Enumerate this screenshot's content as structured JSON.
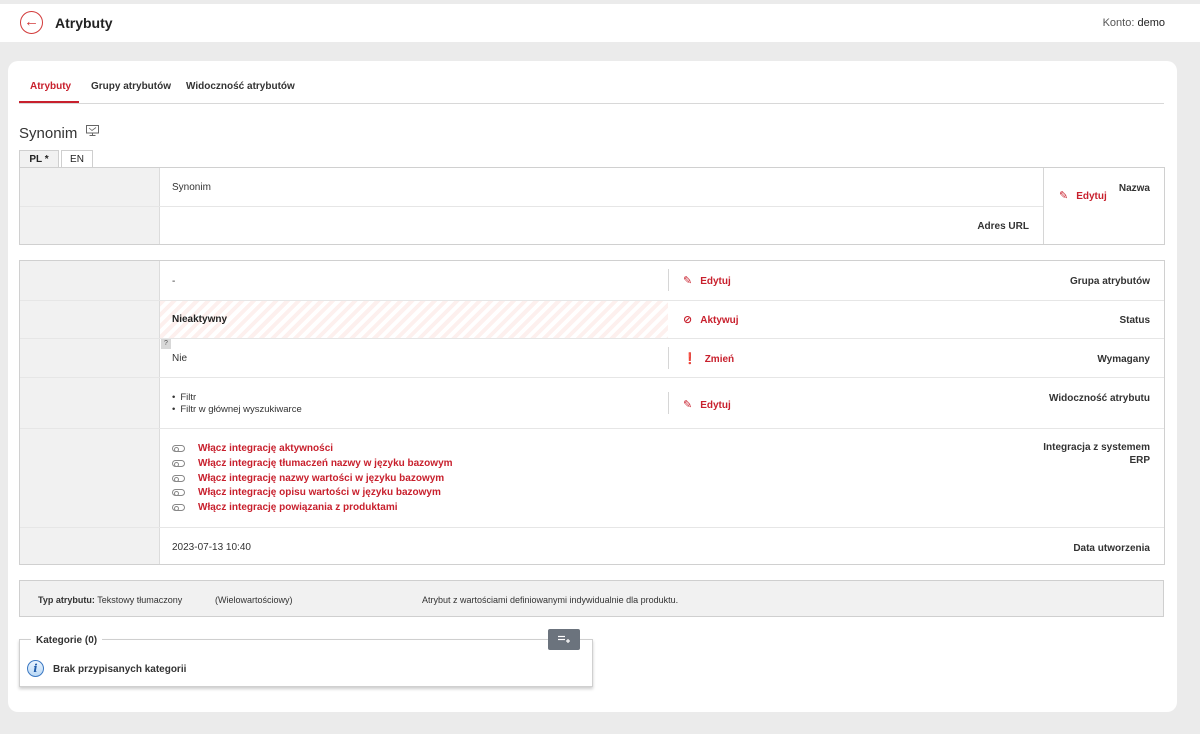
{
  "header": {
    "title": "Atrybuty",
    "account_label": "Konto:",
    "account_name": "demo",
    "back_icon": "arrow-left-icon"
  },
  "tabs": [
    {
      "label": "Atrybuty",
      "active": true
    },
    {
      "label": "Grupy atrybutów",
      "active": false
    },
    {
      "label": "Widoczność atrybutów",
      "active": false
    }
  ],
  "attribute": {
    "name": "Synonim"
  },
  "language_tabs": [
    "PL *",
    "EN"
  ],
  "translation_box": {
    "rows": [
      {
        "label": "Nazwa",
        "value": "Synonim"
      },
      {
        "label": "Adres URL",
        "value": ""
      }
    ],
    "edit_label": "Edytuj"
  },
  "details": {
    "group": {
      "label": "Grupa atrybutów",
      "value": "-",
      "action": "Edytuj"
    },
    "status": {
      "label": "Status",
      "value": "Nieaktywny",
      "action": "Aktywuj"
    },
    "required": {
      "label": "Wymagany",
      "value": "Nie",
      "action": "Zmień",
      "help": "?"
    },
    "visibility": {
      "label": "Widoczność atrybutu",
      "items": [
        "Filtr",
        "Filtr w głównej wyszukiwarce"
      ],
      "action": "Edytuj"
    },
    "erp": {
      "label": "Integracja z systemem ERP",
      "toggles": [
        "Włącz integrację aktywności",
        "Włącz integrację tłumaczeń nazwy w języku bazowym",
        "Włącz integrację nazwy wartości w języku bazowym",
        "Włącz integrację opisu wartości w języku bazowym",
        "Włącz integrację powiązania z produktami"
      ]
    },
    "created": {
      "label": "Data utworzenia",
      "value": "2023-07-13 10:40"
    }
  },
  "type_bar": {
    "type_label": "Typ atrybutu:",
    "type_value": "Tekstowy tłumaczony",
    "multi": "(Wielowartościowy)",
    "description": "Atrybut z wartościami definiowanymi indywidualnie dla produktu."
  },
  "categories": {
    "title": "Kategorie (0)",
    "empty_message": "Brak przypisanych kategorii",
    "add_icon": "list-add-icon"
  },
  "colors": {
    "accent": "#c8202d",
    "label_bg": "#f1f1f1",
    "button_gray": "#6b737d"
  }
}
